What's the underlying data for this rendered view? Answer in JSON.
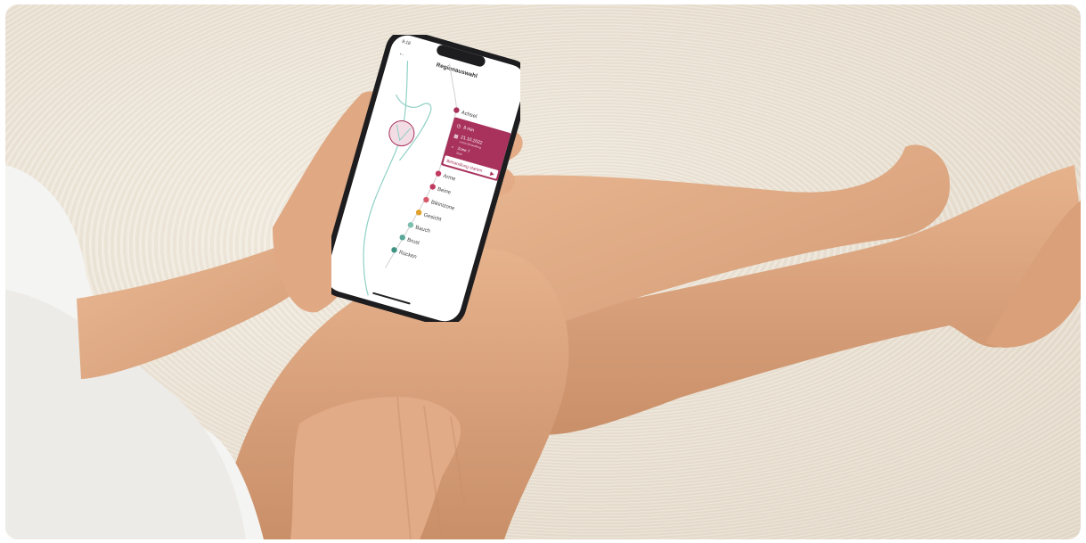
{
  "phone": {
    "status_time": "8:18",
    "header_title": "Regionauswahl",
    "regions": [
      {
        "label": "Achsel",
        "color": "#a8325c"
      },
      {
        "label": "Arme",
        "color": "#c0395e"
      },
      {
        "label": "Beine",
        "color": "#c0395e"
      },
      {
        "label": "Bikinizone",
        "color": "#d85a6a"
      },
      {
        "label": "Gesicht",
        "color": "#e0a02a"
      },
      {
        "label": "Bauch",
        "color": "#7cc0b0"
      },
      {
        "label": "Brust",
        "color": "#5aa898"
      },
      {
        "label": "Rücken",
        "color": "#3f9384"
      }
    ],
    "popup": {
      "duration": "8 min",
      "date": "21.10.2022",
      "date_sub": "Letzte Behandlung",
      "zone": "Zone 7",
      "zone_sub": "Stufe",
      "start_button": "Behandlung starten"
    }
  },
  "colors": {
    "accent": "#a8325c",
    "body_outline": "#8fd0c6",
    "rug": "#ece4d7"
  }
}
